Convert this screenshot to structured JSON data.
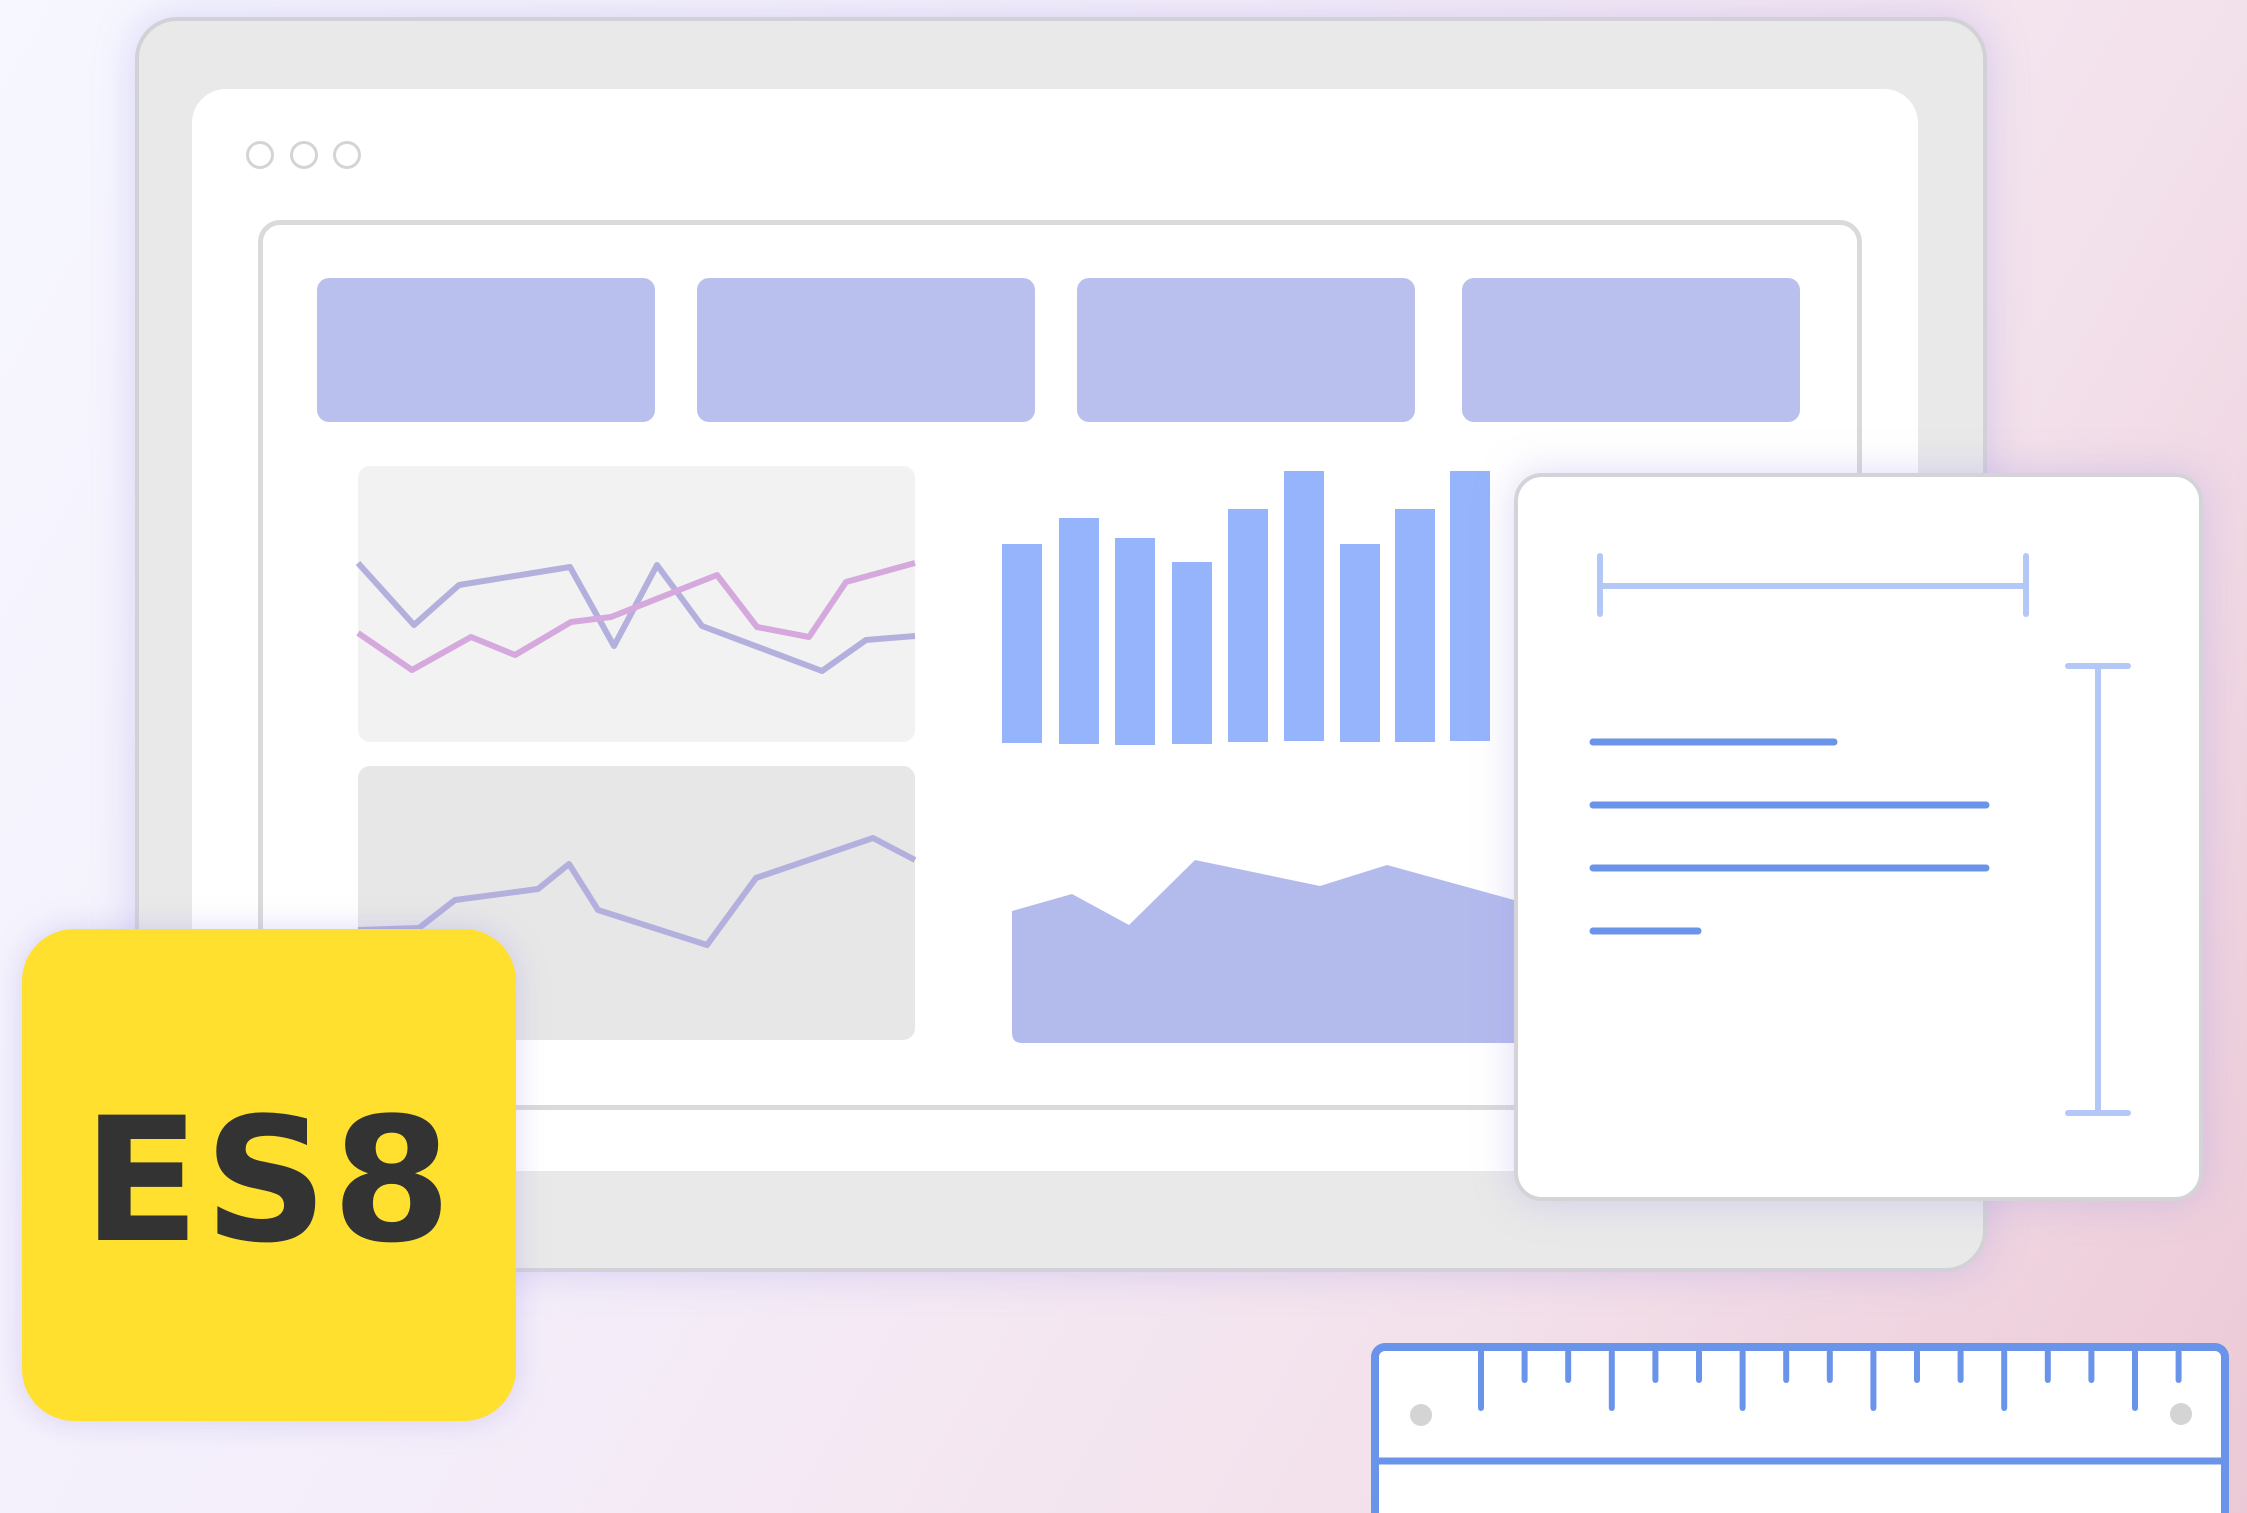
{
  "badge": {
    "label": "ES8",
    "background": "#ffe02e",
    "text_color": "#333333"
  },
  "window_controls": [
    "dot",
    "dot",
    "dot"
  ],
  "kpi_cards": [
    {},
    {},
    {},
    {}
  ],
  "colors": {
    "accent": "#b9c0ee",
    "bar": "#95b4fb",
    "line_a": "#b3b0dd",
    "line_b": "#d5a8de",
    "area": "#b3bbed",
    "spec_line": "#6a93ea",
    "measure": "#b4c8f7",
    "ruler": "#6a93ea"
  },
  "icons": [
    "window-dot-icon",
    "width-measure-icon",
    "height-measure-icon",
    "ruler-icon"
  ]
}
